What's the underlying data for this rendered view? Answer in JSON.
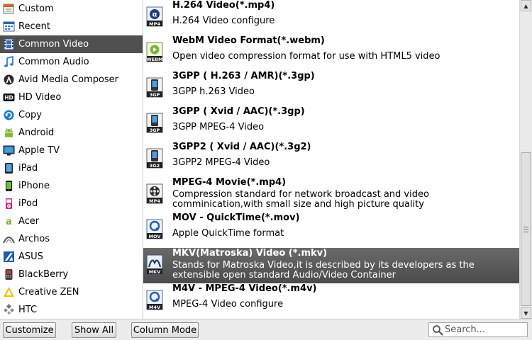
{
  "categories": [
    {
      "label": "Custom",
      "icon": "custom-icon"
    },
    {
      "label": "Recent",
      "icon": "recent-icon"
    },
    {
      "label": "Common Video",
      "icon": "film-icon",
      "selected": true
    },
    {
      "label": "Common Audio",
      "icon": "music-note-icon"
    },
    {
      "label": "Avid Media Composer",
      "icon": "avid-icon"
    },
    {
      "label": "HD Video",
      "icon": "hd-icon"
    },
    {
      "label": "Copy",
      "icon": "copy-icon"
    },
    {
      "label": "Android",
      "icon": "android-icon"
    },
    {
      "label": "Apple TV",
      "icon": "apple-tv-icon"
    },
    {
      "label": "iPad",
      "icon": "ipad-icon"
    },
    {
      "label": "iPhone",
      "icon": "iphone-icon"
    },
    {
      "label": "iPod",
      "icon": "ipod-icon"
    },
    {
      "label": "Acer",
      "icon": "acer-icon"
    },
    {
      "label": "Archos",
      "icon": "archos-icon"
    },
    {
      "label": "ASUS",
      "icon": "asus-icon"
    },
    {
      "label": "BlackBerry",
      "icon": "blackberry-icon"
    },
    {
      "label": "Creative ZEN",
      "icon": "creative-zen-icon"
    },
    {
      "label": "HTC",
      "icon": "htc-icon"
    }
  ],
  "formats": [
    {
      "name": "H.264 Video(*.mp4)",
      "desc": "H.264 Video configure",
      "icon_text": "MP4",
      "icon": "mp4-icon"
    },
    {
      "name": "WebM Video Format(*.webm)",
      "desc": "Open video compression format for use with HTML5 video",
      "icon_text": "WEBM",
      "icon": "webm-icon"
    },
    {
      "name": "3GPP ( H.263 / AMR)(*.3gp)",
      "desc": "3GPP h.263 Video",
      "icon_text": "3GP",
      "icon": "3gp-icon"
    },
    {
      "name": "3GPP ( Xvid / AAC)(*.3gp)",
      "desc": "3GPP MPEG-4 Video",
      "icon_text": "3GP",
      "icon": "3gp-icon"
    },
    {
      "name": "3GPP2 ( Xvid / AAC)(*.3g2)",
      "desc": "3GPP2 MPEG-4 Video",
      "icon_text": "3G2",
      "icon": "3g2-icon"
    },
    {
      "name": "MPEG-4 Movie(*.mp4)",
      "desc": "Compression standard for network broadcast and video comminication,with small size and high picture quality",
      "icon_text": "MP4",
      "icon": "mpeg4-movie-icon",
      "two_line": true
    },
    {
      "name": "MOV - QuickTime(*.mov)",
      "desc": "Apple QuickTime format",
      "icon_text": "MOV",
      "icon": "mov-icon"
    },
    {
      "name": "MKV(Matroska) Video (*.mkv)",
      "desc": "Stands for Matroska Video,it is described by its developers as the extensible open standard Audio/Video Container",
      "icon_text": "MKV",
      "icon": "mkv-icon",
      "selected": true,
      "two_line": true
    },
    {
      "name": "M4V - MPEG-4 Video(*.m4v)",
      "desc": "MPEG-4 Video configure",
      "icon_text": "M4V",
      "icon": "m4v-icon"
    }
  ],
  "bottom": {
    "customize_label": "Customize",
    "show_all_label": "Show All",
    "column_mode_label": "Column Mode",
    "search_placeholder": "Search..."
  },
  "colors": {
    "selected_category_bg": "#505050",
    "selected_format_bg": "#5a5a5a"
  }
}
